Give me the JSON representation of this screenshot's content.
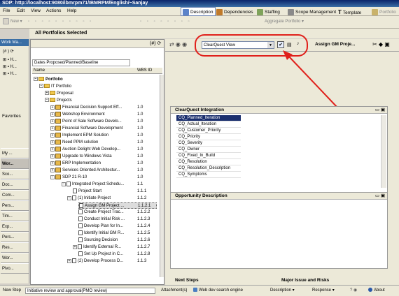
{
  "window": {
    "title": "SDP: http://localhost:9080/ibmrpm71/IBMRPM/English/~Sanjay"
  },
  "menu": [
    "File",
    "Edit",
    "View",
    "Actions",
    "Help"
  ],
  "perspectives": [
    "Description",
    "Dependencies",
    "Staffing",
    "Scope Management",
    "Template",
    "Portfolio"
  ],
  "toolbar": {
    "new_label": "New",
    "aggregate_label": "Aggregate Portfolio"
  },
  "page_header": "All Portfolios Selected",
  "left_strip": {
    "header": "Work Ma...",
    "favorites_label": "Favorites",
    "buttons": [
      "My ...",
      "Wor...",
      "Sco...",
      "Doc...",
      "Com...",
      "Pers...",
      "Tim...",
      "Exp...",
      "Pers...",
      "Res...",
      "Wor...",
      "Pivo..."
    ]
  },
  "tree": {
    "filter_label": "Dates Proposed/Planned/Baseline",
    "col_name": "Name",
    "col_wbs": "WBS ID",
    "items": [
      {
        "label": "Portfolio",
        "wbs": ""
      },
      {
        "label": "IT Portfolio",
        "wbs": ""
      },
      {
        "label": "Proposal",
        "wbs": ""
      },
      {
        "label": "Projects",
        "wbs": ""
      },
      {
        "label": "Financial Decision Support Eff...",
        "wbs": "1.0"
      },
      {
        "label": "Webshop Environment",
        "wbs": "1.0"
      },
      {
        "label": "Point of Sale Software Develo...",
        "wbs": "1.0"
      },
      {
        "label": "Financial Software Development",
        "wbs": "1.0"
      },
      {
        "label": "Implement EPM Solution",
        "wbs": "1.0"
      },
      {
        "label": "Need PPM solution",
        "wbs": "1.0"
      },
      {
        "label": "Auction Delight Web Develop...",
        "wbs": "1.0"
      },
      {
        "label": "Upgrade to Windows Vista",
        "wbs": "1.0"
      },
      {
        "label": "ERP Implementation",
        "wbs": "1.0"
      },
      {
        "label": "Services Oriented Architectur...",
        "wbs": "1.0"
      },
      {
        "label": "SDP 21 R-10",
        "wbs": "1.0"
      },
      {
        "label": "Integrated Project Schedu...",
        "wbs": "1.1"
      },
      {
        "label": "Project Start",
        "wbs": "1.1.1"
      },
      {
        "label": "(1) Initiate Project",
        "wbs": "1.1.2"
      },
      {
        "label": "Assign GM Project ...",
        "wbs": "1.1.2.1"
      },
      {
        "label": "Create Project Trac...",
        "wbs": "1.1.2.2"
      },
      {
        "label": "Conduct Initial Risk ...",
        "wbs": "1.1.2.3"
      },
      {
        "label": "Develop Plan for In...",
        "wbs": "1.1.2.4"
      },
      {
        "label": "Identify Initial GM R...",
        "wbs": "1.1.2.5"
      },
      {
        "label": "Sourcing Decision",
        "wbs": "1.1.2.6"
      },
      {
        "label": "Identify External R...",
        "wbs": "1.1.2.7"
      },
      {
        "label": "Set Up Project in C...",
        "wbs": "1.1.2.8"
      },
      {
        "label": "(2) Develop Process D...",
        "wbs": "1.1.3"
      }
    ]
  },
  "view_selector": {
    "value": "ClearQuest View",
    "context_title": "Assign GM Proje..."
  },
  "cq_panel": {
    "title": "ClearQuest Integration",
    "fields": [
      "CQ_Planned_Iteration",
      "CQ_Actual_Iteration",
      "CQ_Customer_Priority",
      "CQ_Priority",
      "CQ_Severity",
      "CQ_Owner",
      "CQ_Fixed_In_Build",
      "CQ_Resolution",
      "CQ_Resolution_Description",
      "CQ_Symptoms"
    ]
  },
  "desc_panel": {
    "title": "Opportunity Description"
  },
  "bottom_panels": {
    "next_steps": "Next Steps",
    "major_issue": "Major Issue and Risks"
  },
  "status": {
    "new_step_label": "New Step",
    "new_step_value": "Initiative review and approval(PMO review)",
    "attachments": "Attachment(s)",
    "search_engine": "Web dev search engine",
    "description": "Description",
    "response": "Response",
    "about": "About"
  },
  "colors": {
    "annotation": "#e0201b",
    "selection": "#1b2f6e",
    "title_bar": "#0a246a"
  }
}
